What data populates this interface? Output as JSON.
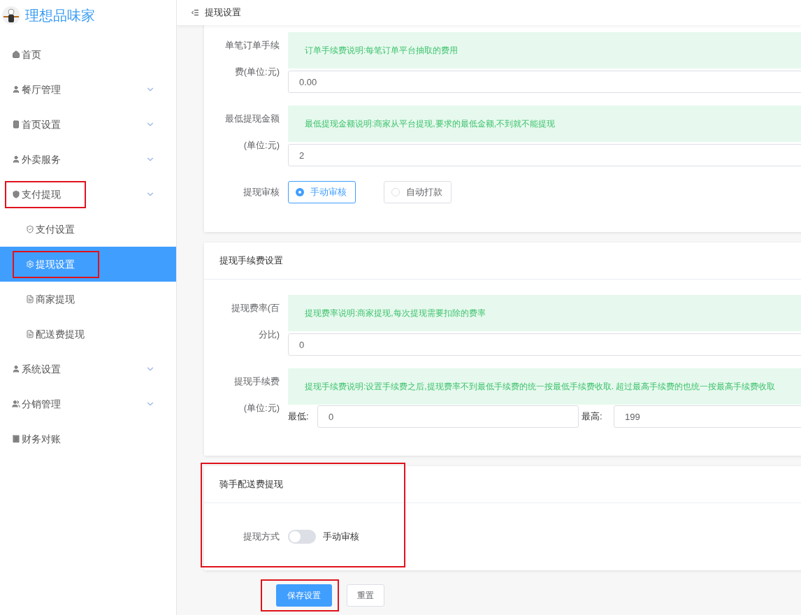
{
  "brand": {
    "name": "理想品味家"
  },
  "sidebar": {
    "items": [
      {
        "label": "首页",
        "expandable": false,
        "selected": false,
        "highlighted": false
      },
      {
        "label": "餐厅管理",
        "expandable": true,
        "selected": false,
        "highlighted": false
      },
      {
        "label": "首页设置",
        "expandable": true,
        "selected": false,
        "highlighted": false
      },
      {
        "label": "外卖服务",
        "expandable": true,
        "selected": false,
        "highlighted": false
      },
      {
        "label": "支付提现",
        "expandable": true,
        "selected": false,
        "highlighted": true,
        "children": [
          {
            "label": "支付设置",
            "selected": false,
            "highlighted": false
          },
          {
            "label": "提现设置",
            "selected": true,
            "highlighted": true
          },
          {
            "label": "商家提现",
            "selected": false,
            "highlighted": false
          },
          {
            "label": "配送费提现",
            "selected": false,
            "highlighted": false
          }
        ]
      },
      {
        "label": "系统设置",
        "expandable": true,
        "selected": false,
        "highlighted": false
      },
      {
        "label": "分销管理",
        "expandable": true,
        "selected": false,
        "highlighted": false
      },
      {
        "label": "财务对账",
        "expandable": false,
        "selected": false,
        "highlighted": false
      }
    ]
  },
  "header": {
    "title": "提现设置"
  },
  "cards": [
    {
      "highlighted": false,
      "rows": [
        {
          "kind": "hint_input",
          "label": [
            "单笔订单手续",
            "费(单位:元)"
          ],
          "hint": "订单手续费说明:每笔订单平台抽取的费用",
          "value": "0.00"
        },
        {
          "kind": "hint_input",
          "label": [
            "最低提现金额",
            "(单位:元)"
          ],
          "hint": "最低提现金额说明:商家从平台提现,要求的最低金额,不到就不能提现",
          "value": "2"
        },
        {
          "kind": "radio",
          "label": [
            "提现审核"
          ],
          "options": [
            {
              "label": "手动审核",
              "selected": true
            },
            {
              "label": "自动打款",
              "selected": false
            }
          ]
        }
      ]
    },
    {
      "title": "提现手续费设置",
      "highlighted": false,
      "rows": [
        {
          "kind": "hint_input",
          "label": [
            "提现费率(百",
            "分比)"
          ],
          "hint": "提现费率说明:商家提现,每次提现需要扣除的费率",
          "value": "0"
        },
        {
          "kind": "range",
          "label": [
            "提现手续费",
            "(单位:元)"
          ],
          "hint": "提现手续费说明:设置手续费之后,提现费率不到最低手续费的统一按最低手续费收取. 超过最高手续费的也统一按最高手续费收取",
          "min_label": "最低:",
          "min_value": "0",
          "max_label": "最高:",
          "max_value": "199"
        }
      ]
    },
    {
      "title": "骑手配送费提现",
      "highlighted": true,
      "rows": [
        {
          "kind": "switch",
          "label": [
            "提现方式"
          ],
          "on": false,
          "text": "手动审核"
        }
      ]
    }
  ],
  "actions": {
    "highlighted": true,
    "buttons": [
      {
        "label": "保存设置",
        "kind": "primary"
      },
      {
        "label": "重置",
        "kind": "default"
      }
    ]
  }
}
